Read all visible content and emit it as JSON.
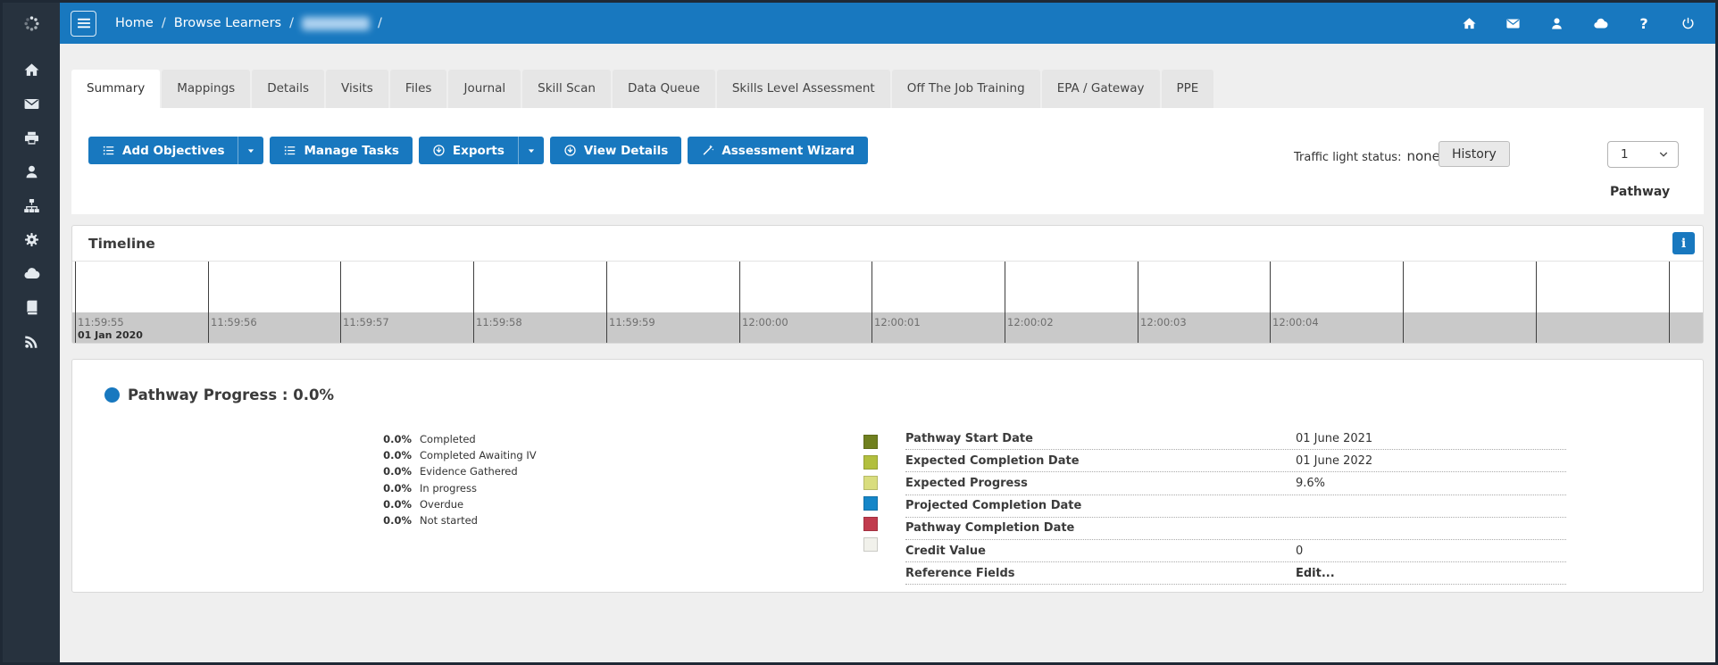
{
  "colors": {
    "accent_blue": "#1878bf",
    "sidebar_bg": "#27323e",
    "timeline_band": "#c9c9c9",
    "status_colors": [
      "#70801f",
      "#b2bf3e",
      "#d9dd7e",
      "#1586c8",
      "#c13b4d",
      "#f1f1eb"
    ]
  },
  "topbar": {
    "breadcrumb": {
      "home": "Home",
      "separator": "/",
      "browse_learners": "Browse Learners"
    }
  },
  "tabs": [
    "Summary",
    "Mappings",
    "Details",
    "Visits",
    "Files",
    "Journal",
    "Skill Scan",
    "Data Queue",
    "Skills Level Assessment",
    "Off The Job Training",
    "EPA / Gateway",
    "PPE"
  ],
  "toolbar": {
    "add_objectives": "Add Objectives",
    "manage_tasks": "Manage Tasks",
    "exports": "Exports",
    "view_details": "View Details",
    "assessment_wizard": "Assessment Wizard",
    "traffic_light_label": "Traffic light status:",
    "traffic_light_value": "none",
    "history": "History",
    "pathway_number": "1",
    "pathway_label": "Pathway"
  },
  "timeline": {
    "title": "Timeline",
    "info": "i",
    "start_date": "01 Jan 2020",
    "ticks": [
      "11:59:55",
      "11:59:56",
      "11:59:57",
      "11:59:58",
      "11:59:59",
      "12:00:00",
      "12:00:01",
      "12:00:02",
      "12:00:03",
      "12:00:04"
    ]
  },
  "pathway_progress": {
    "title": "Pathway Progress : 0.0%",
    "legend": [
      {
        "pct": "0.0%",
        "label": "Completed"
      },
      {
        "pct": "0.0%",
        "label": "Completed Awaiting IV"
      },
      {
        "pct": "0.0%",
        "label": "Evidence Gathered"
      },
      {
        "pct": "0.0%",
        "label": "In progress"
      },
      {
        "pct": "0.0%",
        "label": "Overdue"
      },
      {
        "pct": "0.0%",
        "label": "Not started"
      }
    ],
    "details": [
      {
        "label": "Pathway Start Date",
        "value": "01 June 2021"
      },
      {
        "label": "Expected Completion Date",
        "value": "01 June 2022"
      },
      {
        "label": "Expected Progress",
        "value": "9.6%"
      },
      {
        "label": "Projected Completion Date",
        "value": ""
      },
      {
        "label": "Pathway Completion Date",
        "value": ""
      },
      {
        "label": "Credit Value",
        "value": "0"
      },
      {
        "label": "Reference Fields",
        "value": "Edit..."
      }
    ]
  }
}
